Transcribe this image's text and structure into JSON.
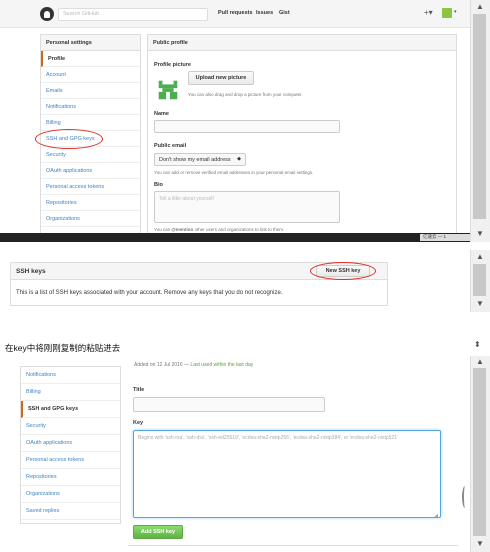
{
  "shot1": {
    "header": {
      "search_placeholder": "Search GitHub",
      "nav": [
        "Pull requests",
        "Issues",
        "Gist"
      ],
      "plus": "+▾",
      "avatar_caret": "▾"
    },
    "sidebar": {
      "heading": "Personal settings",
      "items": [
        "Profile",
        "Account",
        "Emails",
        "Notifications",
        "Billing",
        "SSH and GPG keys",
        "Security",
        "OAuth applications",
        "Personal access tokens",
        "Repositories",
        "Organizations"
      ],
      "active": "Profile"
    },
    "main": {
      "heading": "Public profile",
      "profile_picture_label": "Profile picture",
      "upload_button": "Upload new picture",
      "drag_hint": "You can also drag and drop a picture from your computer.",
      "name_label": "Name",
      "public_email_label": "Public email",
      "public_email_select": "Don't show my email address",
      "public_email_hint": "You can add or remove verified email addresses in your personal email settings.",
      "bio_label": "Bio",
      "bio_placeholder": "Tell a little about yourself",
      "mention_hint_bold": "@mention",
      "mention_hint_pre": "You can ",
      "mention_hint_post": " other users and organizations to link to them."
    },
    "taskbar_text": "亿速云 — 1"
  },
  "shot2": {
    "title": "SSH keys",
    "new_button": "New SSH key",
    "description": "This is a list of SSH keys associated with your account. Remove any keys that you do not recognize."
  },
  "caption": "在key中将刚刚复制的粘贴进去",
  "shot3": {
    "added_prefix": "Added on 12 Jul 2016 —",
    "added_suffix": " Last used within the last day",
    "sidebar": [
      "Notifications",
      "Billing",
      "SSH and GPG keys",
      "Security",
      "OAuth applications",
      "Personal access tokens",
      "Repositories",
      "Organizations",
      "Saved replies"
    ],
    "active": "SSH and GPG keys",
    "title_label": "Title",
    "key_label": "Key",
    "key_placeholder": "Begins with 'ssh-rsa', 'ssh-dss', 'ssh-ed25519', 'ecdsa-sha2-nistp256', 'ecdsa-sha2-nistp384', or 'ecdsa-sha2-nistp521'",
    "add_button": "Add SSH key"
  },
  "colors": {
    "link": "#4183c4",
    "annotation": "#e0302a",
    "green_button": "#60b044",
    "active_marker": "#d26911"
  }
}
